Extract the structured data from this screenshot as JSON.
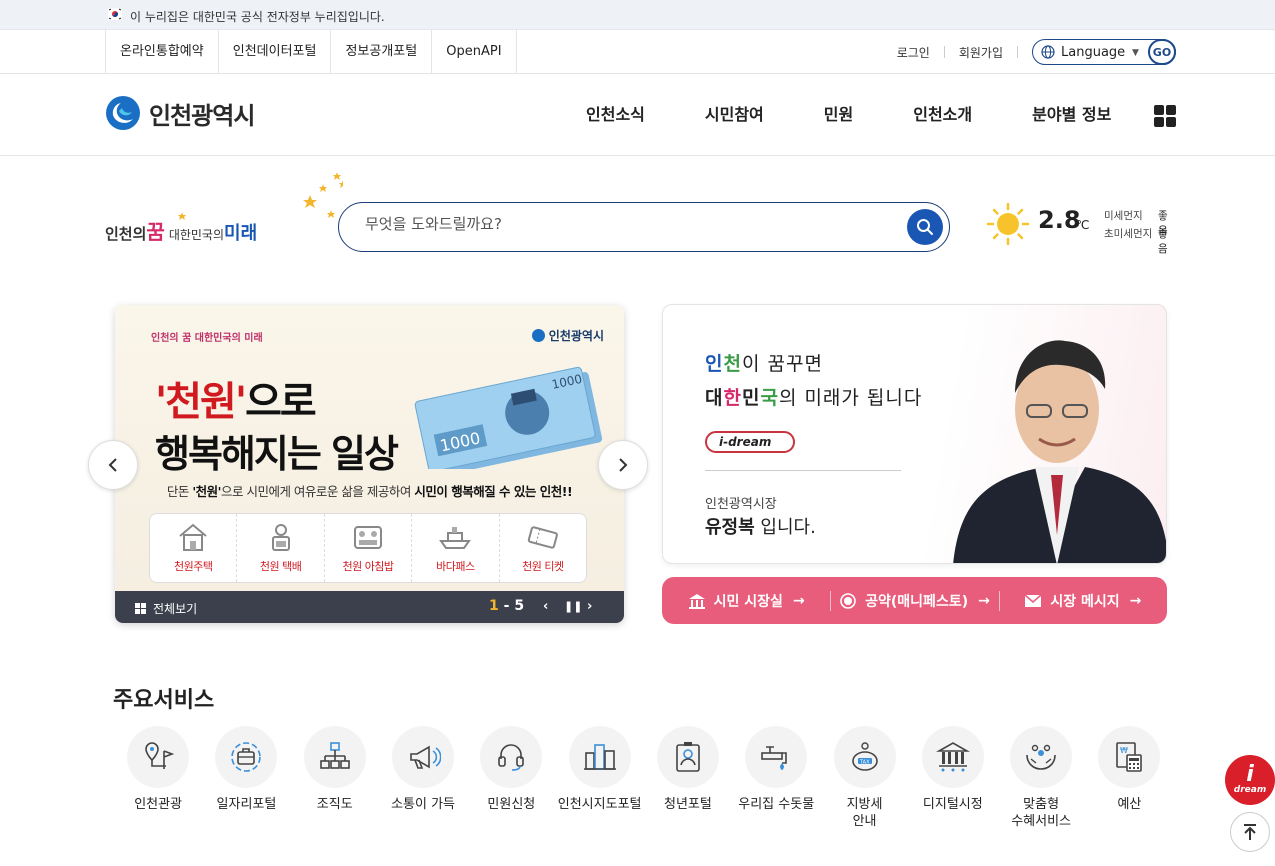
{
  "gov_notice": "이 누리집은 대한민국 공식 전자정부 누리집입니다.",
  "util_links": [
    "온라인통합예약",
    "인천데이터포털",
    "정보공개포털",
    "OpenAPI"
  ],
  "account": {
    "login": "로그인",
    "signup": "회원가입"
  },
  "language": {
    "label": "Language",
    "go": "GO"
  },
  "logo_text": "인천광역시",
  "main_menu": [
    "인천소식",
    "시민참여",
    "민원",
    "인천소개",
    "분야별 정보"
  ],
  "slogan": {
    "part1": "인천의",
    "dream": "꿈",
    "part2": "대한민국의",
    "future": "미래"
  },
  "search": {
    "placeholder": "무엇을 도와드릴까요?"
  },
  "weather": {
    "temp": "2.8",
    "unit": "℃",
    "fine_dust_label": "미세먼지",
    "fine_dust_value": "좋음",
    "ultrafine_dust_label": "초미세먼지",
    "ultrafine_dust_value": "좋음"
  },
  "banner": {
    "small_slogan": "인천의 꿈 대한민국의 미래",
    "logo": "인천광역시",
    "headline_red": "'천원'",
    "headline_rest": "으로",
    "headline2": "행복해지는 일상",
    "desc_pre": "단돈 ",
    "desc_b1": "'천원'",
    "desc_mid": "으로 시민에게 여유로운 삶을 제공하여 ",
    "desc_b2": "시민이 행복해질 수 있는 인천!!",
    "services": [
      "천원주택",
      "천원 택배",
      "천원 아침밥",
      "바다패스",
      "천원 티켓"
    ],
    "view_all": "전체보기",
    "page_current": "1",
    "page_sep": "-",
    "page_total": "5"
  },
  "mayor": {
    "line1_a": "인",
    "line1_b": "천",
    "line1_c": "이 꿈꾸면",
    "line2_a": "대",
    "line2_b": "한",
    "line2_c": "민",
    "line2_d": "국",
    "line2_e": "의 미래가 됩니다",
    "brand": "i-dream",
    "title": "인천광역시장",
    "name": "유정복",
    "name_suffix": " 입니다.",
    "links": [
      "시민 시장실",
      "공약(매니페스토)",
      "시장 메시지"
    ]
  },
  "services_title": "주요서비스",
  "services": [
    {
      "label": "인천관광",
      "icon": "map-pin-flag-icon"
    },
    {
      "label": "일자리포털",
      "icon": "briefcase-icon"
    },
    {
      "label": "조직도",
      "icon": "org-chart-icon"
    },
    {
      "label": "소통이 가득",
      "icon": "megaphone-icon"
    },
    {
      "label": "민원신청",
      "icon": "headset-icon"
    },
    {
      "label": "인천시지도포털",
      "icon": "city-buildings-icon"
    },
    {
      "label": "청년포털",
      "icon": "id-card-icon"
    },
    {
      "label": "우리집 수돗물",
      "icon": "water-tap-icon"
    },
    {
      "label": "지방세\n안내",
      "icon": "tax-piggy-icon"
    },
    {
      "label": "디지털시정",
      "icon": "digital-building-icon"
    },
    {
      "label": "맞춤형\n수혜서비스",
      "icon": "hands-people-icon"
    },
    {
      "label": "예산",
      "icon": "budget-calculator-icon"
    }
  ],
  "floating": {
    "idream_i": "i",
    "idream_text": "dream"
  }
}
